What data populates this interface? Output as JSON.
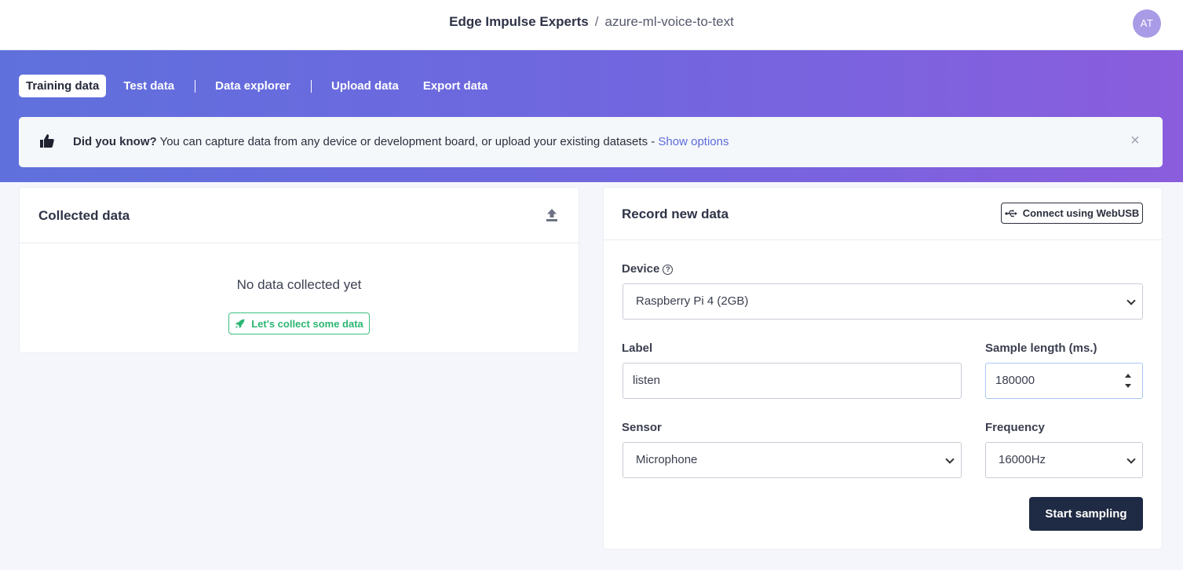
{
  "header": {
    "org": "Edge Impulse Experts",
    "separator": "/",
    "project": "azure-ml-voice-to-text",
    "avatar_initials": "AT"
  },
  "tabs": [
    {
      "label": "Training data",
      "active": true
    },
    {
      "label": "Test data",
      "active": false
    },
    {
      "label": "Data explorer",
      "active": false
    },
    {
      "label": "Upload data",
      "active": false
    },
    {
      "label": "Export data",
      "active": false
    }
  ],
  "notice": {
    "bold": "Did you know?",
    "text": " You can capture data from any device or development board, or upload your existing datasets - ",
    "link": "Show options",
    "close": "×"
  },
  "collected": {
    "title": "Collected data",
    "empty_text": "No data collected yet",
    "collect_button": "Let's collect some data"
  },
  "record": {
    "title": "Record new data",
    "webusb_button": "Connect using WebUSB",
    "device_label": "Device",
    "device_help": "?",
    "device_value": "Raspberry Pi 4 (2GB)",
    "label_label": "Label",
    "label_value": "listen",
    "sample_length_label": "Sample length (ms.)",
    "sample_length_value": "180000",
    "sensor_label": "Sensor",
    "sensor_value": "Microphone",
    "frequency_label": "Frequency",
    "frequency_value": "16000Hz",
    "start_button": "Start sampling"
  },
  "colors": {
    "hero_start": "#5f70dc",
    "hero_end": "#8a5ddd",
    "accent_link": "#5c6bd8",
    "success": "#2bb673",
    "primary_dark": "#1f2a44",
    "avatar": "#a99be6"
  },
  "icons": [
    "thumbs-up-icon",
    "close-icon",
    "upload-icon",
    "rocket-icon",
    "usb-icon",
    "help-icon",
    "chevron-down-icon",
    "spinner-icon"
  ]
}
